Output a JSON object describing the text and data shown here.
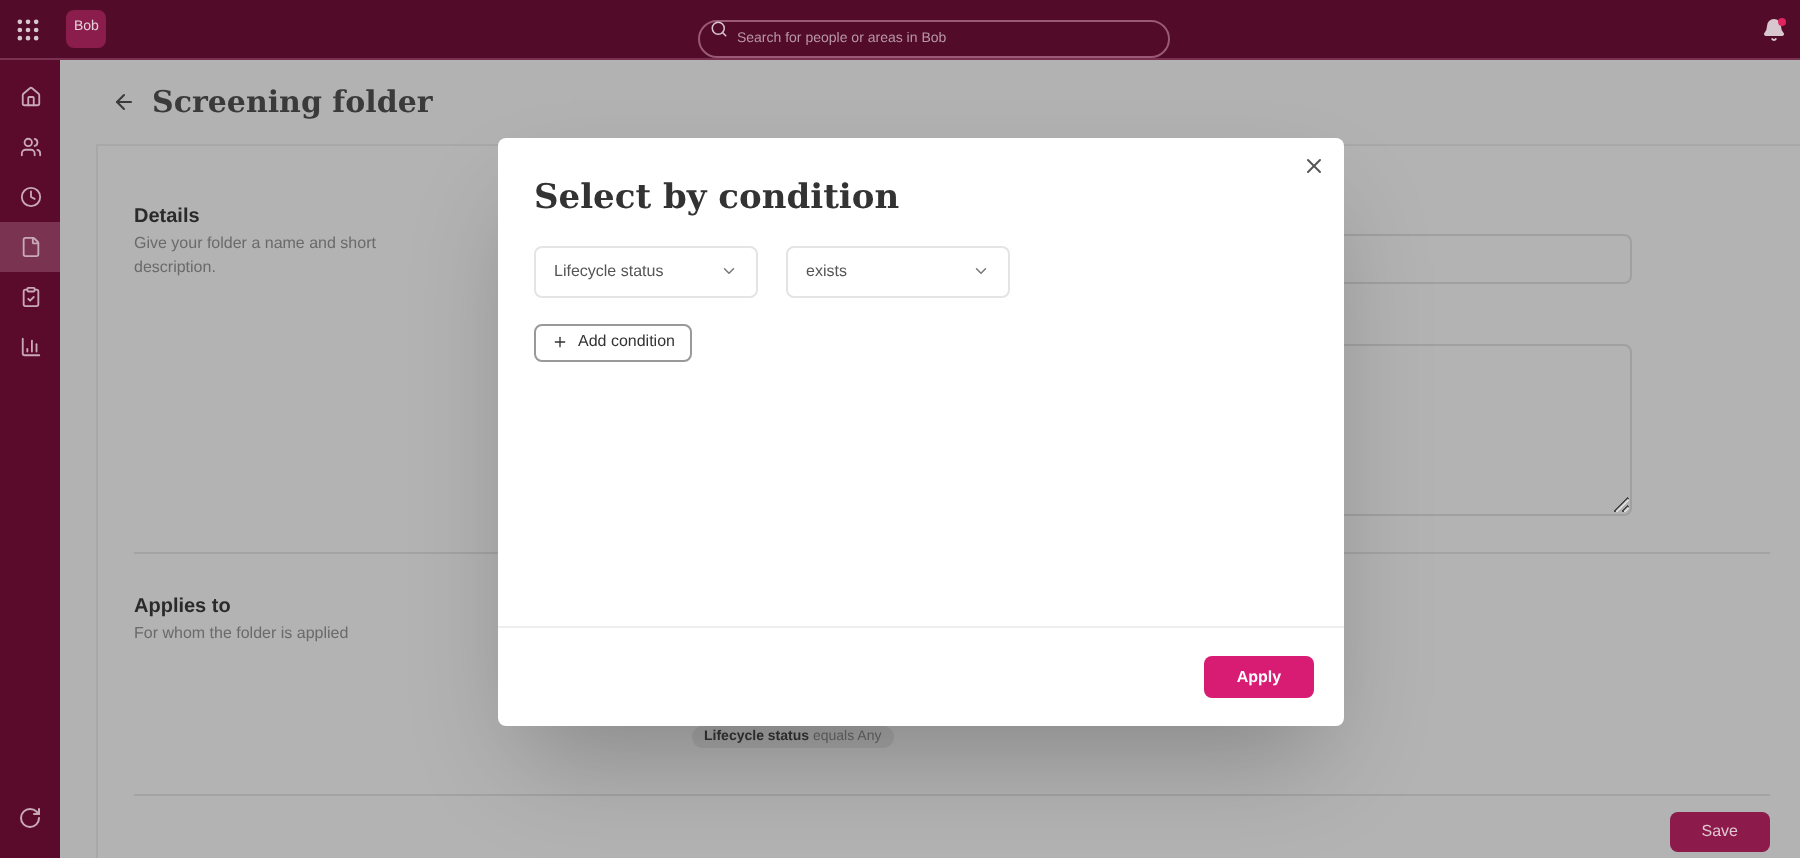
{
  "topbar": {
    "logo": "Bob",
    "search": {
      "placeholder": "Search for people or areas in Bob"
    },
    "notification_dot": true
  },
  "sidebar": {
    "items": [
      {
        "kind": "home",
        "selected": false
      },
      {
        "kind": "people",
        "selected": false
      },
      {
        "kind": "clock",
        "selected": false
      },
      {
        "kind": "document",
        "selected": true
      },
      {
        "kind": "clipboard",
        "selected": false
      },
      {
        "kind": "chart",
        "selected": false
      }
    ]
  },
  "page": {
    "title": "Screening folder",
    "sections": [
      {
        "kind": "details",
        "heading": "Details",
        "description": "Give your folder a name and short description."
      },
      {
        "kind": "applies",
        "heading": "Applies to",
        "description": "For whom the folder is applied",
        "chip": {
          "field": "Lifecycle status",
          "rest": "equals Any"
        }
      }
    ],
    "save_button": "Save"
  },
  "dialog": {
    "title": "Select by condition",
    "conditions": [
      {
        "field": "Lifecycle status",
        "operator": "exists"
      }
    ],
    "add_button": "Add condition",
    "apply_button": "Apply"
  }
}
